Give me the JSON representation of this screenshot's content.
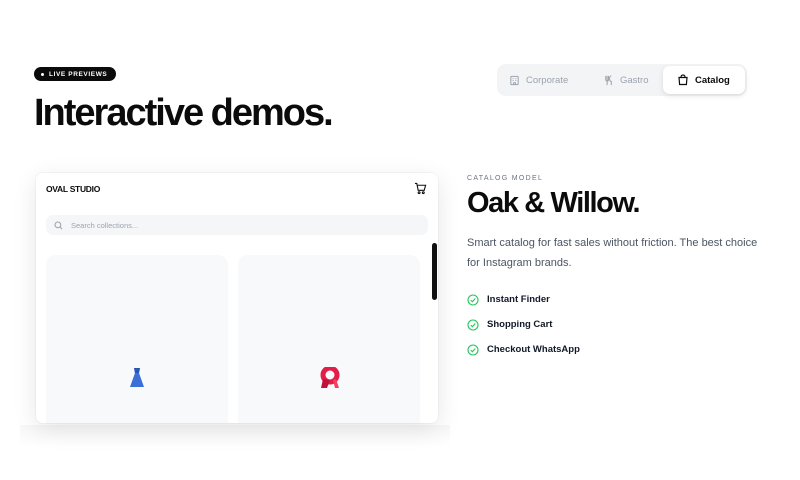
{
  "badge": {
    "label": "LIVE PREVIEWS"
  },
  "heading": "Interactive demos.",
  "tabs": [
    {
      "label": "Corporate",
      "icon": "building-icon",
      "active": false
    },
    {
      "label": "Gastro",
      "icon": "utensils-icon",
      "active": false
    },
    {
      "label": "Catalog",
      "icon": "shopping-bag-icon",
      "active": true
    }
  ],
  "preview": {
    "brand": "OVAL STUDIO",
    "search_placeholder": "Search collections...",
    "products": [
      {
        "icon": "dress-icon",
        "color": "#3b6fd8"
      },
      {
        "icon": "scarf-icon",
        "color": "#e11d48"
      }
    ]
  },
  "model": {
    "label": "CATALOG MODEL",
    "title": "Oak & Willow.",
    "description": "Smart catalog for fast sales without friction. The best choice for Instagram brands.",
    "features": [
      "Instant Finder",
      "Shopping Cart",
      "Checkout WhatsApp"
    ],
    "check_color": "#22c55e"
  }
}
